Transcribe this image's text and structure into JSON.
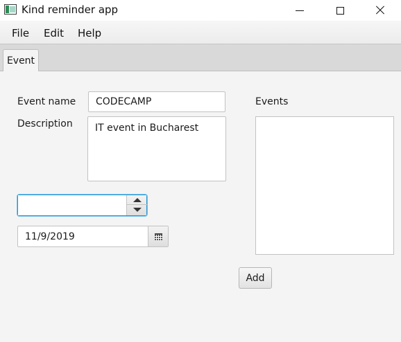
{
  "window": {
    "title": "Kind reminder app",
    "icon": "app-icon"
  },
  "menu": {
    "items": [
      {
        "label": "File"
      },
      {
        "label": "Edit"
      },
      {
        "label": "Help"
      }
    ]
  },
  "tabs": [
    {
      "label": "Event",
      "selected": true
    }
  ],
  "form": {
    "event_name_label": "Event name",
    "event_name_value": "CODECAMP",
    "description_label": "Description",
    "description_value": "IT event in Bucharest",
    "spinner_value": "",
    "date_value": "11/9/2019",
    "events_label": "Events",
    "events_list": [],
    "add_button_label": "Add"
  },
  "colors": {
    "focus_border": "#2196d3",
    "background": "#f4f4f4"
  }
}
